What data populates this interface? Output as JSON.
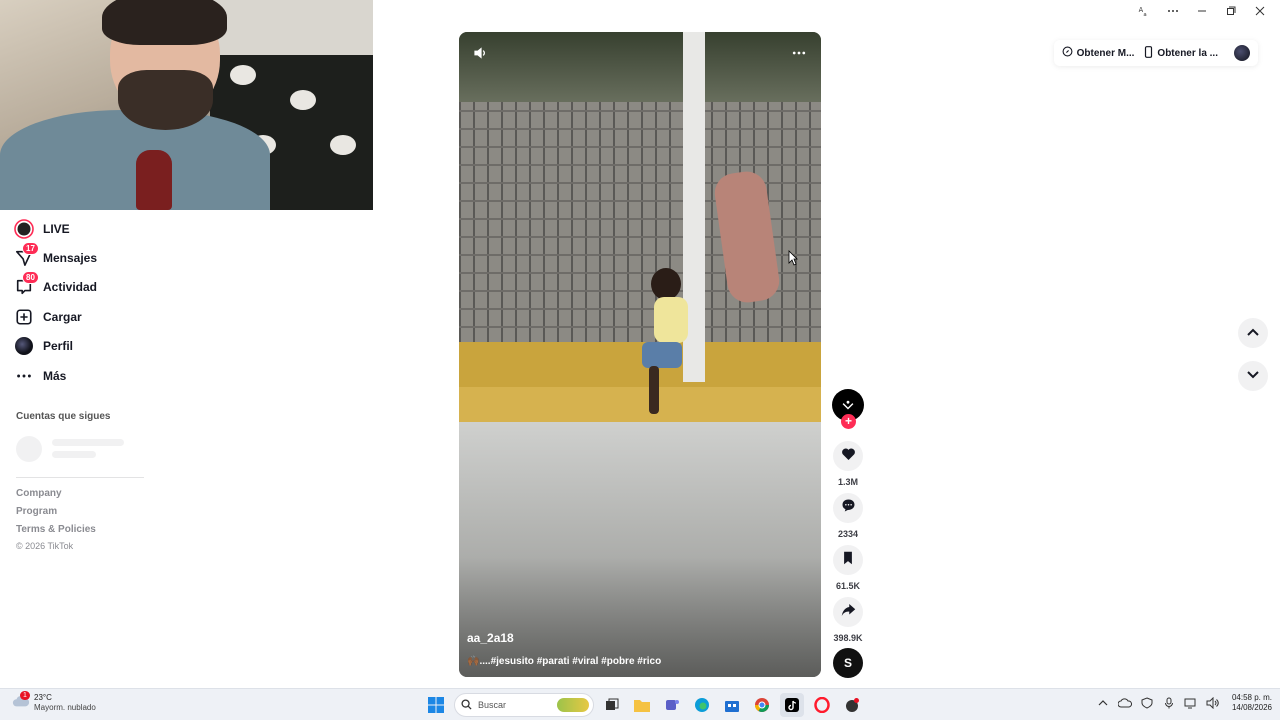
{
  "sidebar": {
    "items": [
      {
        "label": "LIVE",
        "icon": "live-icon"
      },
      {
        "label": "Mensajes",
        "icon": "messages-icon",
        "badge": "17"
      },
      {
        "label": "Actividad",
        "icon": "activity-icon",
        "badge": "80"
      },
      {
        "label": "Cargar",
        "icon": "upload-icon"
      },
      {
        "label": "Perfil",
        "icon": "profile-icon"
      },
      {
        "label": "Más",
        "icon": "more-icon"
      }
    ],
    "following_title": "Cuentas que sigues",
    "footer": {
      "company": "Company",
      "program": "Program",
      "terms": "Terms & Policies",
      "copyright": "© 2026 TikTok"
    }
  },
  "video": {
    "author": "aa_2a18",
    "caption": "🙌🏾....#jesusito #parati #viral #pobre #rico"
  },
  "actions": {
    "likes": "1.3M",
    "comments": "2334",
    "saves": "61.5K",
    "shares": "398.9K",
    "sound_letter": "S"
  },
  "header": {
    "get_app_1": "Obtener M...",
    "get_app_2": "Obtener la ..."
  },
  "taskbar": {
    "weather_temp": "23°C",
    "weather_desc": "Mayorm. nublado",
    "weather_badge": "1",
    "search_placeholder": "Buscar",
    "time": "04:58 p. m.",
    "date": "14/08/2026"
  },
  "colors": {
    "accent": "#fe2c55",
    "text": "#161823",
    "muted": "#8a8b91"
  }
}
